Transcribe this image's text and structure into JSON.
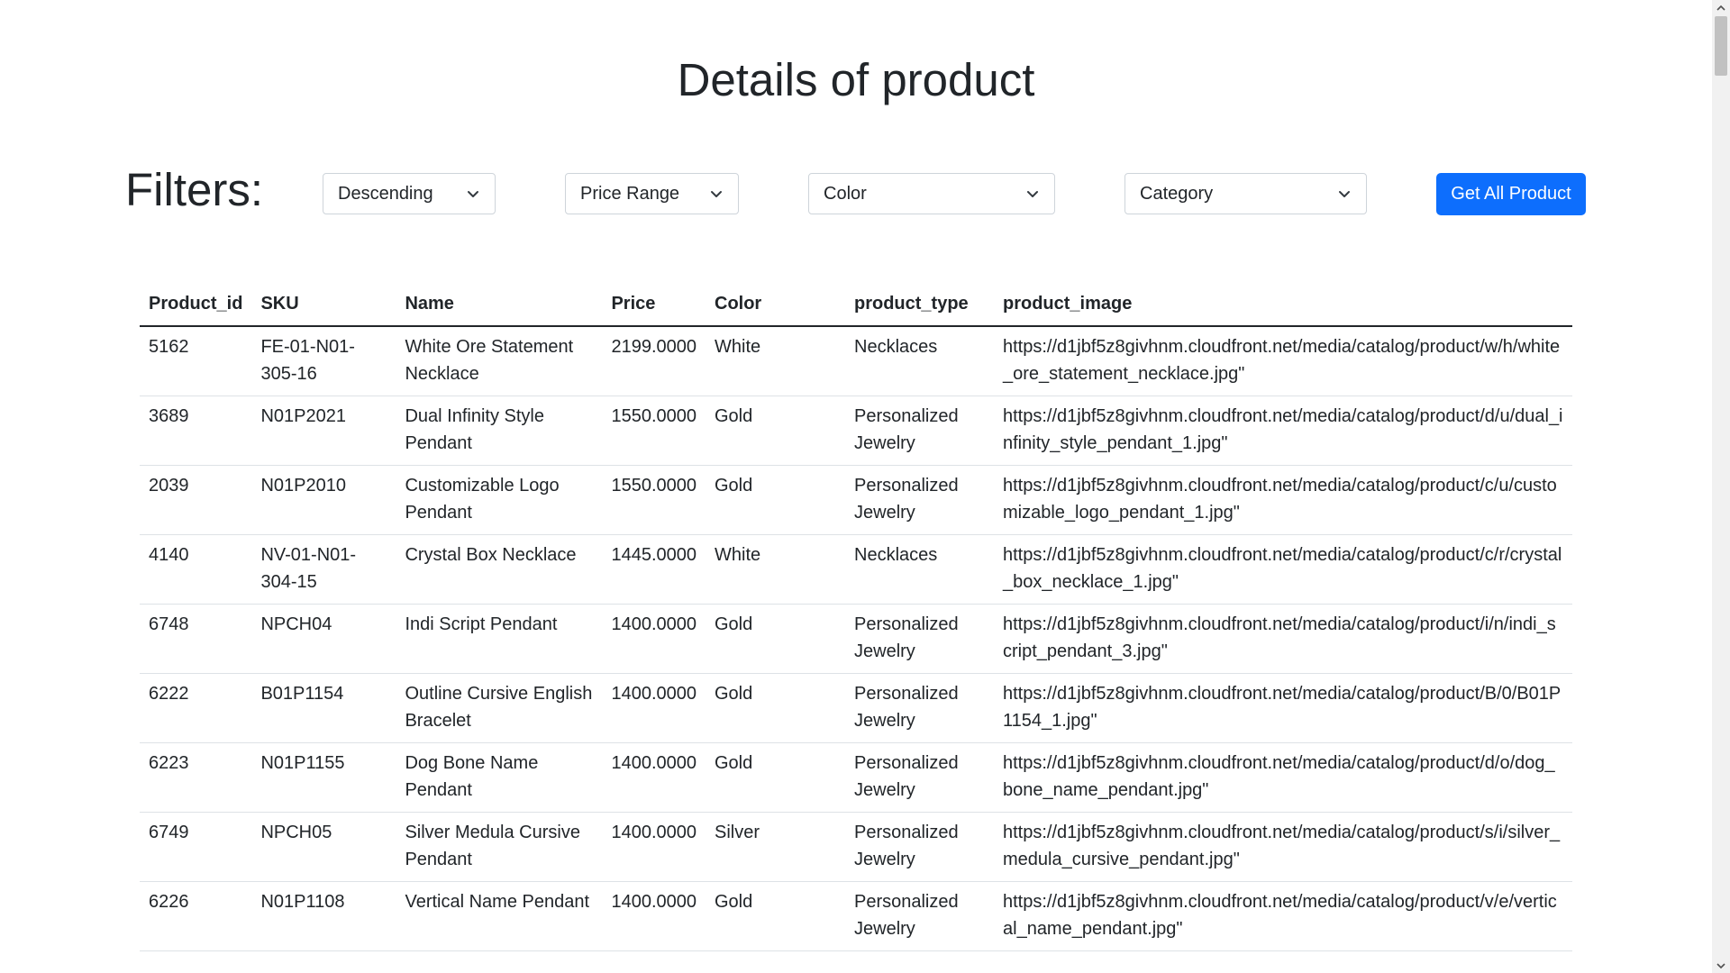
{
  "page": {
    "title": "Details of product"
  },
  "filters": {
    "label": "Filters:",
    "sort_order": "Descending",
    "price_range": "Price Range",
    "color": "Color",
    "category": "Category",
    "get_all_label": "Get All Product"
  },
  "table": {
    "headers": {
      "product_id": "Product_id",
      "sku": "SKU",
      "name": "Name",
      "price": "Price",
      "color": "Color",
      "product_type": "product_type",
      "product_image": "product_image"
    },
    "rows": [
      {
        "product_id": "5162",
        "sku": "FE-01-N01-305-16",
        "name": "White Ore Statement Necklace",
        "price": "2199.0000",
        "color": "White",
        "product_type": "Necklaces",
        "product_image": "https://d1jbf5z8givhnm.cloudfront.net/media/catalog/product/w/h/white_ore_statement_necklace.jpg\""
      },
      {
        "product_id": "3689",
        "sku": "N01P2021",
        "name": "Dual Infinity Style Pendant",
        "price": "1550.0000",
        "color": "Gold",
        "product_type": "Personalized Jewelry",
        "product_image": "https://d1jbf5z8givhnm.cloudfront.net/media/catalog/product/d/u/dual_infinity_style_pendant_1.jpg\""
      },
      {
        "product_id": "2039",
        "sku": "N01P2010",
        "name": "Customizable Logo Pendant",
        "price": "1550.0000",
        "color": "Gold",
        "product_type": "Personalized Jewelry",
        "product_image": "https://d1jbf5z8givhnm.cloudfront.net/media/catalog/product/c/u/customizable_logo_pendant_1.jpg\""
      },
      {
        "product_id": "4140",
        "sku": "NV-01-N01-304-15",
        "name": "Crystal Box Necklace",
        "price": "1445.0000",
        "color": "White",
        "product_type": "Necklaces",
        "product_image": "https://d1jbf5z8givhnm.cloudfront.net/media/catalog/product/c/r/crystal_box_necklace_1.jpg\""
      },
      {
        "product_id": "6748",
        "sku": "NPCH04",
        "name": "Indi Script Pendant",
        "price": "1400.0000",
        "color": "Gold",
        "product_type": "Personalized Jewelry",
        "product_image": "https://d1jbf5z8givhnm.cloudfront.net/media/catalog/product/i/n/indi_script_pendant_3.jpg\""
      },
      {
        "product_id": "6222",
        "sku": "B01P1154",
        "name": "Outline Cursive English Bracelet",
        "price": "1400.0000",
        "color": "Gold",
        "product_type": "Personalized Jewelry",
        "product_image": "https://d1jbf5z8givhnm.cloudfront.net/media/catalog/product/B/0/B01P1154_1.jpg\""
      },
      {
        "product_id": "6223",
        "sku": "N01P1155",
        "name": "Dog Bone Name Pendant",
        "price": "1400.0000",
        "color": "Gold",
        "product_type": "Personalized Jewelry",
        "product_image": "https://d1jbf5z8givhnm.cloudfront.net/media/catalog/product/d/o/dog_bone_name_pendant.jpg\""
      },
      {
        "product_id": "6749",
        "sku": "NPCH05",
        "name": "Silver Medula Cursive Pendant",
        "price": "1400.0000",
        "color": "Silver",
        "product_type": "Personalized Jewelry",
        "product_image": "https://d1jbf5z8givhnm.cloudfront.net/media/catalog/product/s/i/silver_medula_cursive_pendant.jpg\""
      },
      {
        "product_id": "6226",
        "sku": "N01P1108",
        "name": "Vertical Name Pendant",
        "price": "1400.0000",
        "color": "Gold",
        "product_type": "Personalized Jewelry",
        "product_image": "https://d1jbf5z8givhnm.cloudfront.net/media/catalog/product/v/e/vertical_name_pendant.jpg\""
      }
    ]
  },
  "colors": {
    "primary_button": "#0d6efd",
    "text": "#212529",
    "border": "#ced4da",
    "row_divider": "#dee2e6"
  },
  "icons": {
    "dropdown": "chevron-down-icon",
    "scroll_up": "scroll-up-arrow-icon",
    "scroll_down": "scroll-down-arrow-icon"
  }
}
